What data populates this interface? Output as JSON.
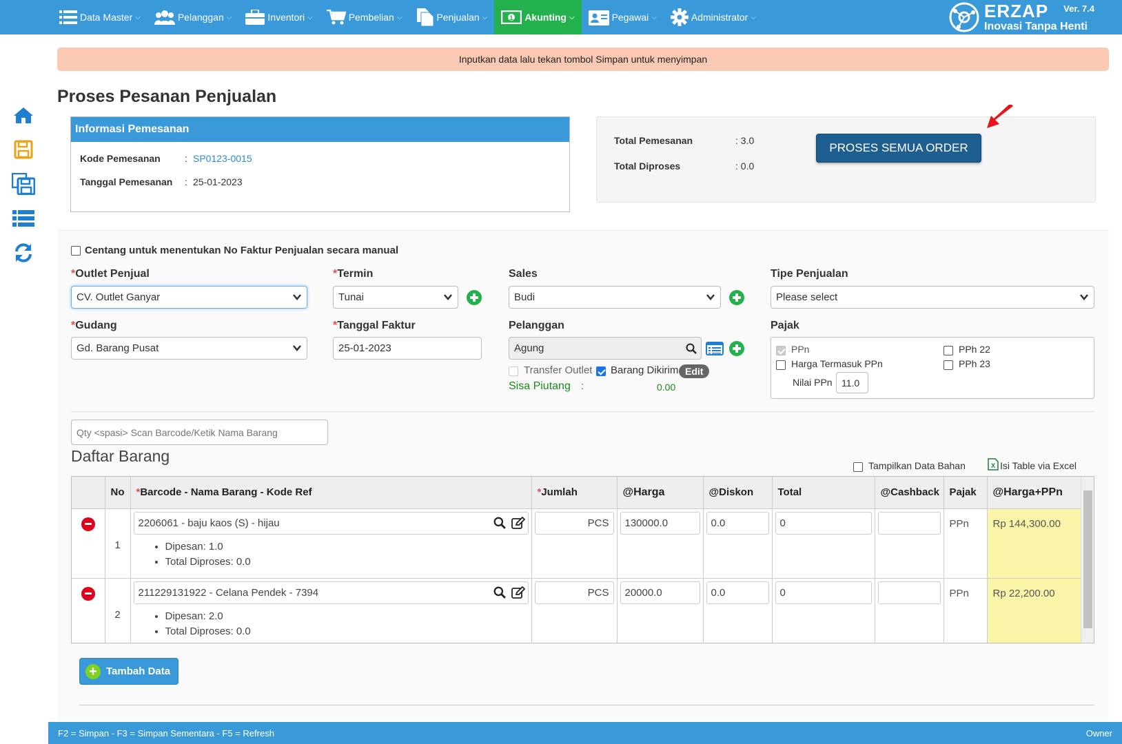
{
  "nav": {
    "items": [
      {
        "label": "Data Master",
        "icon": "list-icon"
      },
      {
        "label": "Pelanggan",
        "icon": "users-icon"
      },
      {
        "label": "Inventori",
        "icon": "briefcase-icon"
      },
      {
        "label": "Pembelian",
        "icon": "cart-icon"
      },
      {
        "label": "Penjualan",
        "icon": "document-icon"
      },
      {
        "label": "Akunting",
        "icon": "money-icon"
      },
      {
        "label": "Pegawai",
        "icon": "id-card-icon"
      },
      {
        "label": "Administrator",
        "icon": "gear-icon"
      }
    ],
    "active": "Akunting"
  },
  "brand": {
    "name": "ERZAP",
    "version": "Ver. 7.4",
    "tagline": "Inovasi Tanpa Henti"
  },
  "alert": "Inputkan data lalu tekan tombol Simpan untuk menyimpan",
  "page_title": "Proses Pesanan Penjualan",
  "info": {
    "header": "Informasi Pemesanan",
    "kode_label": "Kode Pemesanan",
    "kode_value": "SP0123-0015",
    "tanggal_label": "Tanggal Pemesanan",
    "tanggal_value": "25-01-2023",
    "sep": ":"
  },
  "summary": {
    "total_pemesanan_label": "Total Pemesanan",
    "total_pemesanan_value": ": 3.0",
    "total_diproses_label": "Total Diproses",
    "total_diproses_value": ": 0.0",
    "button": "PROSES SEMUA ORDER"
  },
  "form": {
    "manual_faktur_label": "Centang untuk menentukan No Faktur Penjualan secara manual",
    "required_mark": "*",
    "outlet_label": "Outlet Penjual",
    "outlet_value": "CV. Outlet Ganyar",
    "termin_label": "Termin",
    "termin_value": "Tunai",
    "sales_label": "Sales",
    "sales_value": "Budi",
    "tipe_label": "Tipe Penjualan",
    "tipe_value": "Please select",
    "gudang_label": "Gudang",
    "gudang_value": "Gd. Barang Pusat",
    "tanggal_faktur_label": "Tanggal Faktur",
    "tanggal_faktur_value": "25-01-2023",
    "pelanggan_label": "Pelanggan",
    "pelanggan_value": "Agung",
    "transfer_outlet_label": "Transfer Outlet",
    "barang_dikirim_label": "Barang Dikirim",
    "edit_label": "Edit",
    "sisa_piutang_label": "Sisa Piutang",
    "sisa_piutang_sep": ":",
    "sisa_piutang_value": "0.00",
    "pajak_label": "Pajak",
    "pajak": {
      "ppn": "PPn",
      "harga_termasuk_ppn": "Harga Termasuk PPn",
      "nilai_ppn_label": "Nilai PPn",
      "nilai_ppn_value": "11.0",
      "pph22": "PPh 22",
      "pph23": "PPh 23"
    }
  },
  "barang": {
    "scan_placeholder": "Qty <spasi> Scan Barcode/Ketik Nama Barang",
    "title": "Daftar Barang",
    "tampilkan_bahan": "Tampilkan Data Bahan",
    "isi_excel": "Isi Table via Excel",
    "columns": [
      "No",
      "Barcode - Nama Barang - Kode Ref",
      "Jumlah",
      "@Harga",
      "@Diskon",
      "Total",
      "@Cashback",
      "Pajak",
      "@Harga+PPn"
    ],
    "rows": [
      {
        "no": "1",
        "item": "2206061 - baju kaos (S) - hijau",
        "dipesan": "Dipesan: 1.0",
        "diproses": "Total Diproses: 0.0",
        "unit": "PCS",
        "harga": "130000.0",
        "diskon": "0.0",
        "total": "0",
        "cashback": "",
        "pajak": "PPn",
        "harga_ppn": "Rp 144,300.00"
      },
      {
        "no": "2",
        "item": "211229131922 - Celana Pendek - 7394",
        "dipesan": "Dipesan: 2.0",
        "diproses": "Total Diproses: 0.0",
        "unit": "PCS",
        "harga": "20000.0",
        "diskon": "0.0",
        "total": "0",
        "cashback": "",
        "pajak": "PPn",
        "harga_ppn": "Rp 22,200.00"
      }
    ],
    "tambah_button": "Tambah Data"
  },
  "footer": {
    "shortcuts": "F2 = Simpan - F3 = Simpan Sementara - F5 = Refresh",
    "user": "Owner"
  },
  "colors": {
    "primary": "#3a9ad9",
    "active_nav": "#22b14c",
    "alert_bg": "#fac9b4",
    "proses_btn": "#1e5f8f",
    "highlight": "#fbf5a9"
  }
}
